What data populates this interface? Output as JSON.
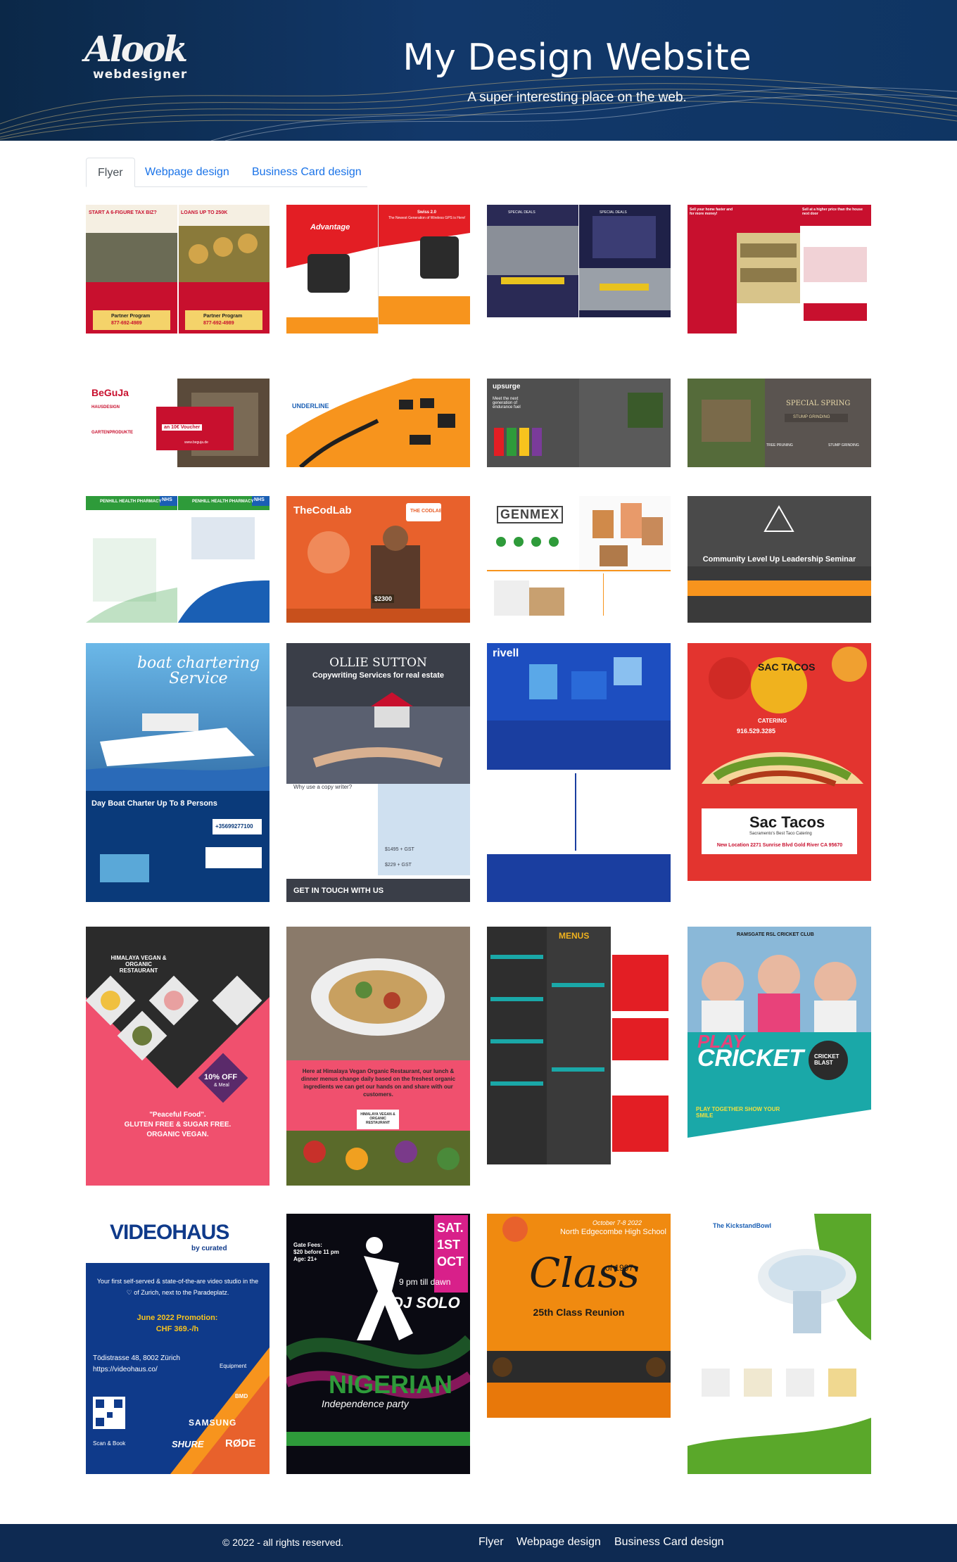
{
  "header": {
    "logo_mark": "Alook",
    "logo_sub": "webdesigner",
    "title": "My Design Website",
    "subtitle": "A super interesting place on the web."
  },
  "tabs": [
    {
      "label": "Flyer",
      "active": true
    },
    {
      "label": "Webpage design",
      "active": false
    },
    {
      "label": "Business Card design",
      "active": false
    }
  ],
  "flyers": {
    "f1": {
      "l1": "START A 6-FIGURE TAX BIZ?",
      "l2": "LOANS UP TO 250K",
      "l3": "Partner Program",
      "l4": "877-692-4989"
    },
    "f2": {
      "l1": "Advantage",
      "l2": "Swiss 2.0",
      "l3": "The Newest Generation of Wireless GPS is Here!"
    },
    "f3": {
      "l1": "SPECIAL DEALS"
    },
    "f4": {
      "l1": "Sell your home faster and for more money!",
      "l2": "Sell at a higher price than the house next door"
    },
    "f5": {
      "l1": "BeGuJa",
      "l2": "HAUSDESIGN",
      "l3": "GARTENPRODUKTE",
      "l4": "an 10€ Voucher",
      "l5": "www.beguja.de"
    },
    "f6": {
      "l1": "UNDERLINE"
    },
    "f7": {
      "l1": "upsurge",
      "l2": "Meet the next generation of endurance fuel"
    },
    "f8": {
      "l1": "SPECIAL SPRING",
      "l2": "STUMP GRINDING",
      "l3": "TREE PRUNING",
      "l4": "STUMP GRINDING"
    },
    "f9": {
      "l1": "PENHILL HEALTH PHARMACY",
      "l2": "NHS"
    },
    "f10": {
      "l1": "TheCodLab",
      "l2": "$2300",
      "l3": "THE CODLAB"
    },
    "f11": {
      "l1": "GENMEX"
    },
    "f12": {
      "l1": "Community Level Up Leadership Seminar"
    },
    "f13": {
      "l1": "boat chartering Service",
      "l2": "Day Boat Charter Up To 8 Persons",
      "l3": "+35699277100"
    },
    "f14": {
      "l1": "OLLIE SUTTON",
      "l2": "Copywriting Services for real estate",
      "l3": "Why use a copy writer?",
      "l4": "GET IN TOUCH WITH US",
      "l5": "$1495 + GST",
      "l6": "$229 + GST"
    },
    "f15": {
      "l1": "rivell"
    },
    "f16": {
      "l1": "SAC TACOS",
      "l2": "916.529.3285",
      "l3": "CATERING",
      "l4": "Sac Tacos",
      "l5": "Sacramento's Best Taco Catering",
      "l6": "New Location 2271 Sunrise Blvd Gold River CA 95670"
    },
    "f17": {
      "l1": "HIMALAYA VEGAN & ORGANIC RESTAURANT",
      "l2": "10% OFF",
      "l3": "& Meal",
      "l4": "\"Peaceful Food\".",
      "l5": "GLUTEN FREE & SUGAR FREE.",
      "l6": "ORGANIC VEGAN."
    },
    "f18": {
      "l1": "Here at Himalaya Vegan Organic Restaurant, our lunch & dinner menus change daily based on the freshest organic ingredients we can get our hands on and share with our customers.",
      "l2": "HIMALAYA VEGAN & ORGANIC RESTAURANT"
    },
    "f19": {
      "l1": "MENUS"
    },
    "f20": {
      "l1": "RAMSGATE RSL CRICKET CLUB",
      "l2": "PLAY",
      "l3": "CRICKET",
      "l4": "CRICKET BLAST",
      "l5": "PLAY TOGETHER SHOW YOUR SMILE"
    },
    "f21": {
      "l1": "VIDEOHAUS",
      "l2": "by curated",
      "l3": "Your first self-served & state-of-the-are video studio in the ♡ of Zurich, next to the Paradeplatz.",
      "l4": "June 2022 Promotion:",
      "l5": "CHF 369.-/h",
      "l6": "Tödistrasse 48, 8002 Zürich",
      "l7": "https://videohaus.co/",
      "l8": "Scan & Book",
      "l9": "SAMSUNG",
      "l10": "SHURE",
      "l11": "RØDE",
      "l12": "BMD",
      "l13": "Equipment"
    },
    "f22": {
      "l1": "SAT.",
      "l2": "1ST",
      "l3": "OCT",
      "l4": "9 pm till dawn",
      "l5": "DJ SOLO",
      "l6": "NIGERIAN",
      "l7": "Independence party",
      "l8": "Gate Fees:",
      "l9": "$20 before 11 pm",
      "l10": "Age: 21+"
    },
    "f23": {
      "l1": "October 7-8 2022",
      "l2": "North Edgecombe High School",
      "l3": "Class",
      "l4": "of 1997",
      "l5": "25th Class Reunion"
    },
    "f24": {
      "l1": "The KickstandBowl"
    }
  },
  "footer": {
    "copyright": "© 2022 - all rights reserved.",
    "links": [
      "Flyer",
      "Webpage design",
      "Business Card design"
    ]
  }
}
